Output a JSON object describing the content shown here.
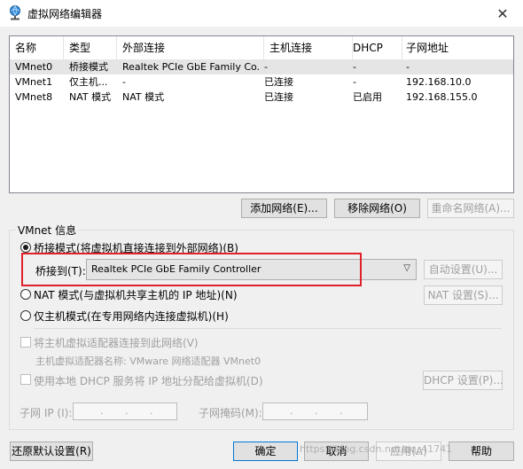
{
  "window": {
    "title": "虚拟网络编辑器",
    "close_glyph": "✕"
  },
  "network_table": {
    "columns": [
      "名称",
      "类型",
      "外部连接",
      "主机连接",
      "DHCP",
      "子网地址"
    ],
    "rows": [
      [
        "VMnet0",
        "桥接模式",
        "Realtek PCIe GbE Family Co...",
        "-",
        "-",
        "-"
      ],
      [
        "VMnet1",
        "仅主机...",
        "-",
        "已连接",
        "-",
        "192.168.10.0"
      ],
      [
        "VMnet8",
        "NAT 模式",
        "NAT 模式",
        "已连接",
        "已启用",
        "192.168.155.0"
      ]
    ]
  },
  "table_buttons": {
    "add": "添加网络(E)...",
    "remove": "移除网络(O)",
    "rename": "重命名网络(A)..."
  },
  "vmnet_info": {
    "label": "VMnet 信息",
    "bridged_radio": "桥接模式(将虚拟机直接连接到外部网络)(B)",
    "bridged_to_label": "桥接到(T):",
    "bridged_to_value": "Realtek PCIe GbE Family Controller",
    "auto_settings": "自动设置(U)...",
    "nat_radio": "NAT 模式(与虚拟机共享主机的 IP 地址)(N)",
    "nat_settings": "NAT 设置(S)...",
    "hostonly_radio": "仅主机模式(在专用网络内连接虚拟机)(H)",
    "connect_adapter": "将主机虚拟适配器连接到此网络(V)",
    "adapter_name": "主机虚拟适配器名称: VMware 网络适配器 VMnet0",
    "use_dhcp": "使用本地 DHCP 服务将 IP 地址分配给虚拟机(D)",
    "dhcp_settings": "DHCP 设置(P)...",
    "subnet_ip_label": "子网 IP (I):",
    "subnet_mask_label": "子网掩码(M):"
  },
  "footer": {
    "restore": "还原默认设置(R)",
    "ok": "确定",
    "cancel": "取消",
    "apply": "应用(A)",
    "help": "帮助"
  },
  "watermark": "https://blog.csdn.net/qq_41741"
}
